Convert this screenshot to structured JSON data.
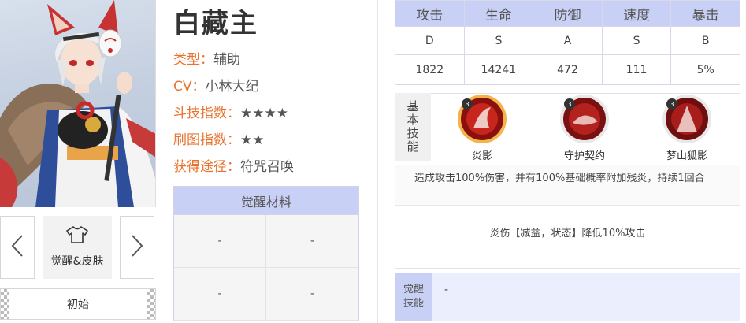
{
  "character": {
    "name": "白藏主",
    "info": [
      {
        "key": "类型：",
        "value": "辅助"
      },
      {
        "key": "CV：",
        "value": "小林大纪"
      },
      {
        "key": "斗技指数：",
        "value": "★★★★"
      },
      {
        "key": "刷图指数：",
        "value": "★★"
      },
      {
        "key": "获得途径：",
        "value": "符咒召唤"
      }
    ]
  },
  "controls": {
    "skin_label": "觉醒&皮肤",
    "origin_label": "初始"
  },
  "materials": {
    "title": "觉醒材料",
    "cells": [
      "-",
      "-",
      "-",
      "-"
    ]
  },
  "stats": {
    "headers": [
      "攻击",
      "生命",
      "防御",
      "速度",
      "暴击"
    ],
    "grades": [
      "D",
      "S",
      "A",
      "S",
      "B"
    ],
    "values": [
      "1822",
      "14241",
      "472",
      "111",
      "5%"
    ]
  },
  "skills": {
    "side_label_chars": [
      "基",
      "本",
      "技",
      "能"
    ],
    "items": [
      {
        "name": "炎影",
        "icon": "flame-shadow-skill-icon",
        "selected": true
      },
      {
        "name": "守护契约",
        "icon": "guardian-contract-skill-icon",
        "selected": false
      },
      {
        "name": "梦山狐影",
        "icon": "fox-shadow-skill-icon",
        "selected": false
      }
    ],
    "description": "造成攻击100%伤害，并有100%基础概率附加残炎，持续1回合",
    "effect": "炎伤【减益，状态】降低10%攻击"
  },
  "awaken_skill": {
    "label_chars": [
      "觉醒",
      "技能"
    ],
    "value": "-"
  },
  "colors": {
    "accent_orange": "#e8732f",
    "header_blue": "#c9d0f5",
    "awaken_bg": "#ebeefc"
  }
}
